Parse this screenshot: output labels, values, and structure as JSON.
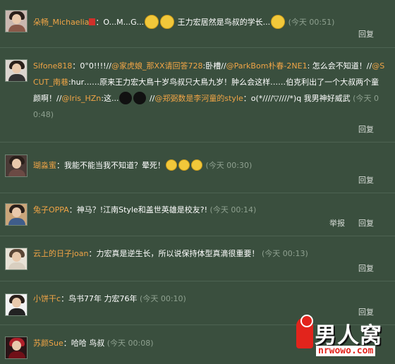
{
  "comments": [
    {
      "name": "朵畅_Michaelia",
      "segments": [
        {
          "type": "text",
          "value": "：O...M...G..."
        },
        {
          "type": "emoji",
          "value": "shocked-face"
        },
        {
          "type": "emoji",
          "value": "crying-face"
        },
        {
          "type": "text",
          "value": "  王力宏居然是鸟叔的学长..."
        },
        {
          "type": "emoji",
          "value": "sweating-face"
        }
      ],
      "time": "(今天 00:51)",
      "reply": "回复"
    },
    {
      "name": "Sifone818",
      "segments": [
        {
          "type": "text",
          "value": "：0°0!!!!//"
        },
        {
          "type": "mention",
          "value": "@家虎娘_那XX请回答728"
        },
        {
          "type": "text",
          "value": ":卧槽//"
        },
        {
          "type": "mention",
          "value": "@ParkBom朴春-2NE1"
        },
        {
          "type": "text",
          "value": ": 怎么会不知道！//"
        },
        {
          "type": "mention",
          "value": "@SCUT_南巷"
        },
        {
          "type": "text",
          "value": ":hur……原来王力宏大鳥十岁鸟叔只大鳥九岁！肿么会这样……伯克利出了一个大叔两个童颜啊！//"
        },
        {
          "type": "mention",
          "value": "@Iris_HZn"
        },
        {
          "type": "text",
          "value": ":这..."
        },
        {
          "type": "blackball",
          "value": "black-ball-emoji"
        },
        {
          "type": "blackball",
          "value": "black-ball-emoji"
        },
        {
          "type": "text",
          "value": " //"
        },
        {
          "type": "mention",
          "value": "@郑弼数是李河童的style"
        },
        {
          "type": "text",
          "value": "：o(*////▽////*)q 我男神好威武"
        }
      ],
      "time": "(今天 00:48)",
      "reply": "回复"
    },
    {
      "name": "瑚淼蜜",
      "segments": [
        {
          "type": "text",
          "value": "：我能不能当我不知道？晕死！"
        },
        {
          "type": "emoji",
          "value": "smug-face"
        },
        {
          "type": "emoji",
          "value": "smug-face"
        },
        {
          "type": "emoji",
          "value": "smug-face"
        }
      ],
      "time": "(今天 00:30)",
      "reply": "回复"
    },
    {
      "name": "兔子OPPA",
      "segments": [
        {
          "type": "text",
          "value": "：神马？!江南Style和盖世英雄是校友?!"
        }
      ],
      "time": "(今天 00:14)",
      "report": "举报",
      "reply": "回复"
    },
    {
      "name": "云上的日子joan",
      "segments": [
        {
          "type": "text",
          "value": "：力宏真是逆生长，所以说保持体型真滴很重要！"
        }
      ],
      "time": "(今天 00:13)",
      "reply": "回复"
    },
    {
      "name": "小饼干c",
      "segments": [
        {
          "type": "text",
          "value": "：鸟书77年 力宏76年"
        }
      ],
      "time": "(今天 00:10)",
      "reply": "回复"
    },
    {
      "name": "苏颜Sue",
      "segments": [
        {
          "type": "text",
          "value": "：哈哈 鸟叔"
        }
      ],
      "time": "(今天 00:08)"
    }
  ],
  "watermark": {
    "title": "男人窝",
    "url": "nrwowo.com"
  },
  "colors": {
    "background": "#3a4f3e",
    "name": "#f0a446",
    "time": "#8ea08f",
    "text": "#ffffff"
  }
}
